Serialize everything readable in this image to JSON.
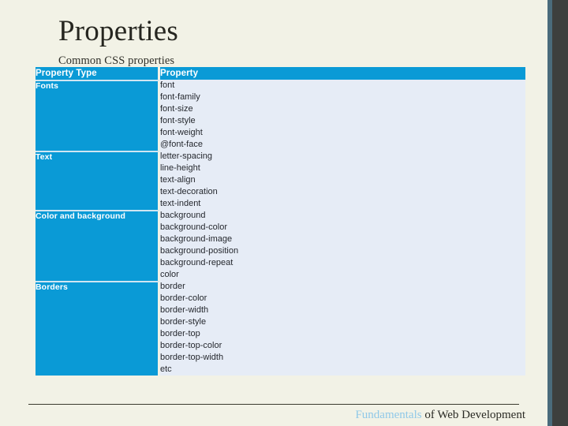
{
  "slide": {
    "title": "Properties",
    "subtitle": "Common CSS properties"
  },
  "table": {
    "headers": {
      "type": "Property Type",
      "property": "Property"
    },
    "rows": [
      {
        "type": "Fonts",
        "properties": [
          "font",
          "font-family",
          "font-size",
          "font-style",
          "font-weight",
          "@font-face"
        ]
      },
      {
        "type": "Text",
        "properties": [
          "letter-spacing",
          "line-height",
          "text-align",
          "text-decoration",
          "text-indent"
        ]
      },
      {
        "type": "Color and background",
        "properties": [
          "background",
          "background-color",
          "background-image",
          "background-position",
          "background-repeat",
          "color"
        ]
      },
      {
        "type": "Borders",
        "properties": [
          "border",
          "border-color",
          "border-width",
          "border-style",
          "border-top",
          "border-top-color",
          "border-top-width",
          "etc"
        ]
      }
    ]
  },
  "footer": {
    "brand": "Fundamentals",
    "rest": " of Web Development"
  },
  "colors": {
    "accent_cyan": "#0a9ad6",
    "table_body_bg": "#e6ecf6",
    "page_bg": "#f2f2e6",
    "edge_stripe": "#4a6b7c",
    "edge_band": "#3d3f3e",
    "footer_brand": "#8fc8e8"
  }
}
